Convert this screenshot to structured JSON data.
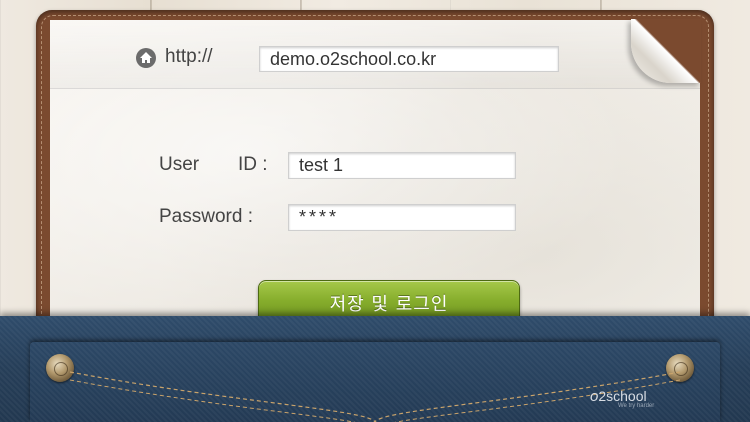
{
  "address_bar": {
    "prefix": "http://",
    "url": "demo.o2school.co.kr"
  },
  "login_form": {
    "user_id_label_user": "User",
    "user_id_label_id": "ID :",
    "user_id_value": "test 1",
    "password_label": "Password :",
    "password_value": "****"
  },
  "actions": {
    "save_login_label": "저장 및 로그인"
  },
  "brand": {
    "logo_prefix": "o",
    "logo_text": "2school",
    "tagline": "We try harder"
  },
  "icons": [
    "home-icon",
    "rivet-left",
    "rivet-right"
  ],
  "colors": {
    "button_green": "#86ad2c",
    "leather": "#7b4a2f",
    "denim": "#263e58"
  }
}
